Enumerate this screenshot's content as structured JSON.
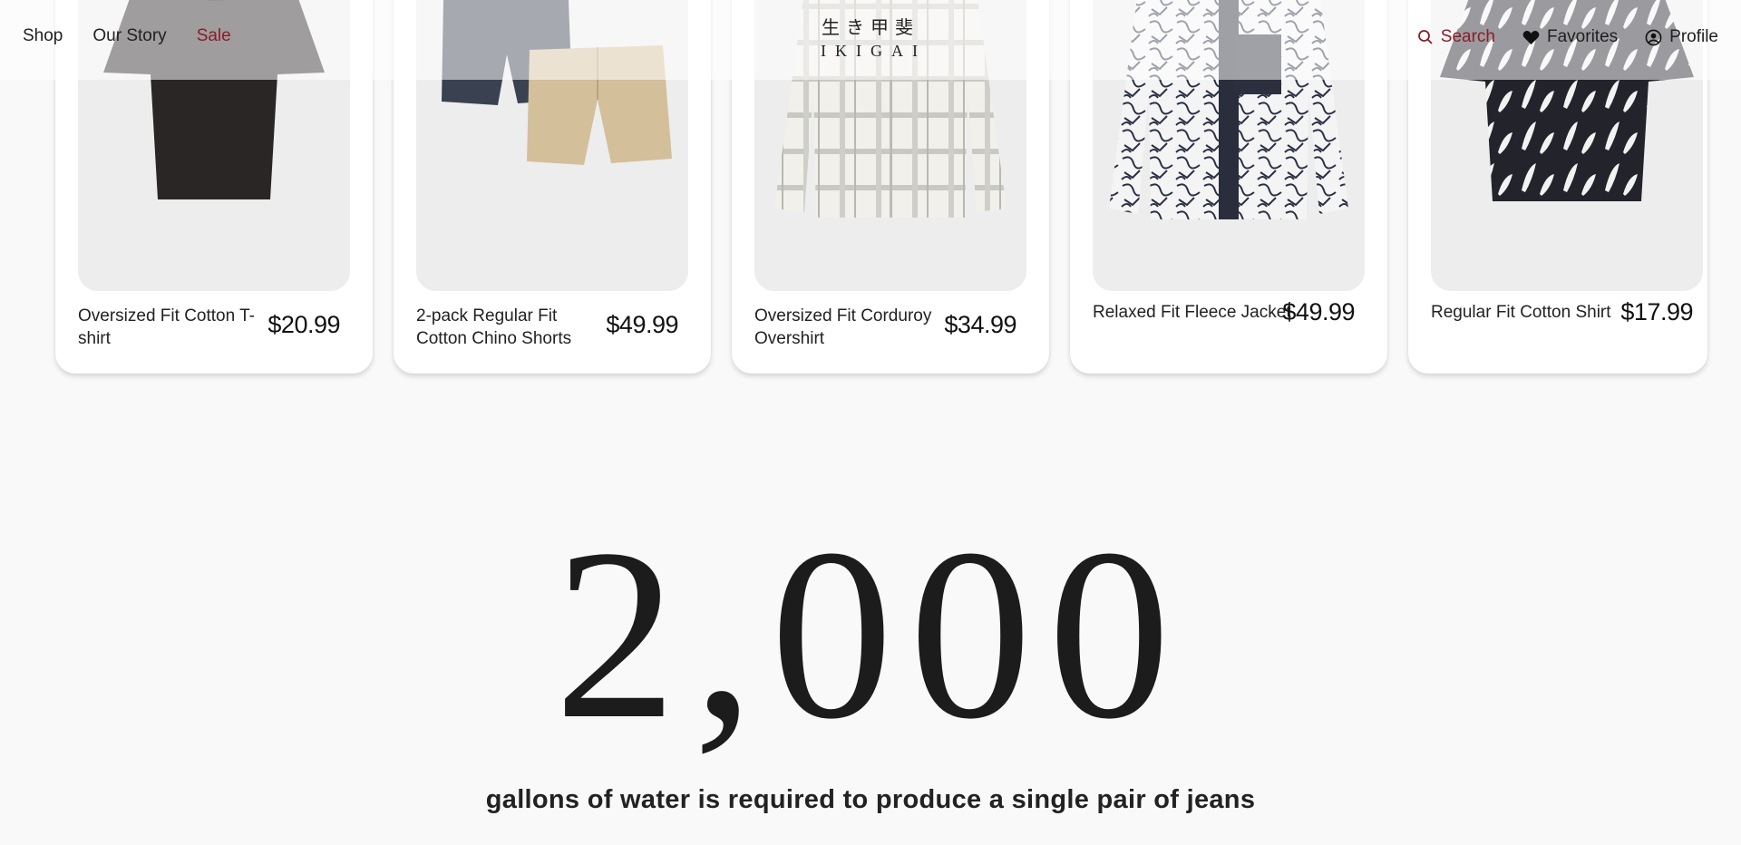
{
  "header": {
    "nav_left": [
      "Shop",
      "Our Story",
      "Sale"
    ],
    "logo_kanji": "生き甲斐",
    "logo_latin": "IKIGAI",
    "nav_right": {
      "search": "Search",
      "favorites": "Favorites",
      "profile": "Profile"
    }
  },
  "products": [
    {
      "name": "Oversized Fit Cotton T-shirt",
      "price": "$20.99",
      "image": "black-tshirt"
    },
    {
      "name": "2-pack Regular Fit Cotton Chino Shorts",
      "price": "$49.99",
      "image": "chino-shorts"
    },
    {
      "name": "Oversized Fit Corduroy Overshirt",
      "price": "$34.99",
      "image": "plaid-overshirt"
    },
    {
      "name": "Relaxed Fit Fleece Jacket",
      "price": "$49.99",
      "image": "printed-fleece-jacket"
    },
    {
      "name": "Regular Fit Cotton Shirt",
      "price": "$17.99",
      "image": "floral-shirt"
    }
  ],
  "stat": {
    "number": "2,000",
    "caption": "gallons of water is required to produce a single pair of jeans"
  },
  "colors": {
    "accent": "#8a1c2b",
    "text": "#1f1f1f",
    "background": "#f9f9f9"
  }
}
